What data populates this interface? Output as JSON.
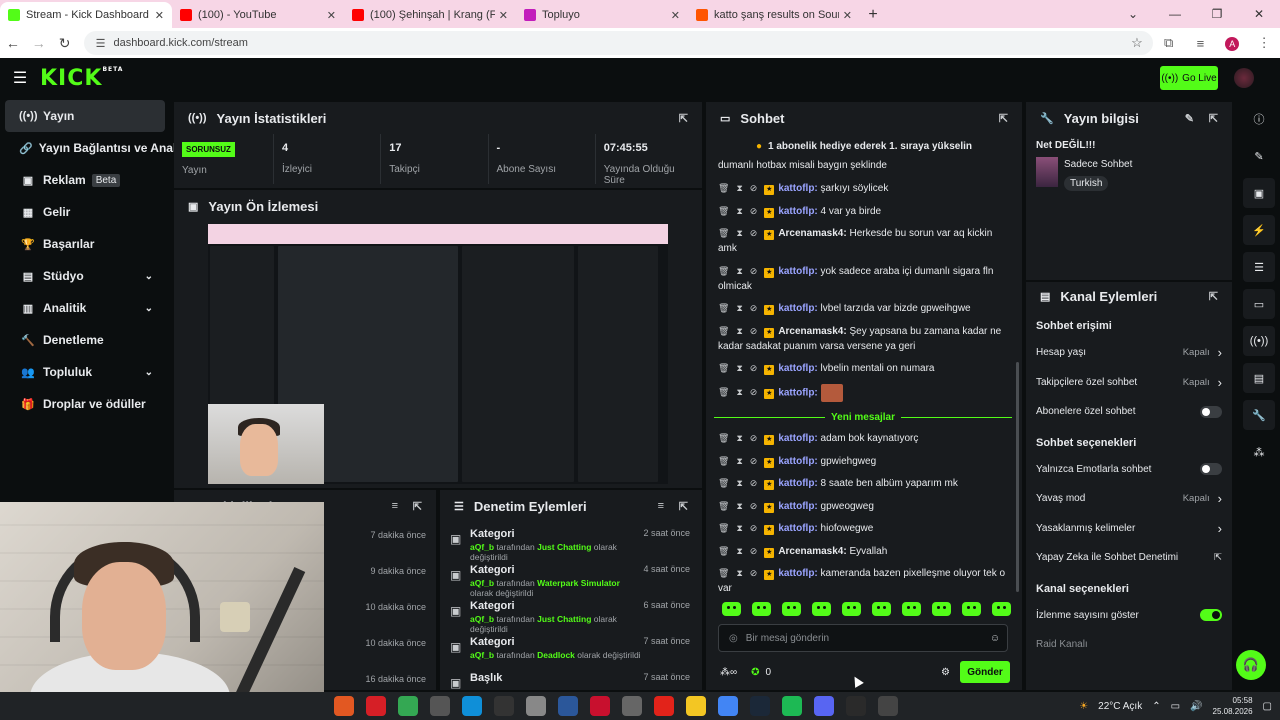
{
  "browser": {
    "tabs": [
      {
        "title": "Stream - Kick Dashboard",
        "color": "#53fc18",
        "active": true
      },
      {
        "title": "(100)                     - YouTube",
        "color": "#ff0000",
        "active": false
      },
      {
        "title": "(100) Şehinşah | Krang (Feat: Hi",
        "color": "#ff0000",
        "active": false
      },
      {
        "title": "Topluyo",
        "color": "#c21cbb",
        "active": false
      },
      {
        "title": "katto şanş results on SoundCloud",
        "color": "#ff5500",
        "active": false
      }
    ],
    "url": "dashboard.kick.com/stream",
    "profile_initial": "A"
  },
  "header": {
    "logo": "KICK",
    "logo_sup": "BETA",
    "go_live": "Go Live"
  },
  "sidebar": {
    "items": [
      {
        "label": "Yayın",
        "icon": "broadcast-icon",
        "glyph": "((•))",
        "active": true
      },
      {
        "label": "Yayın Bağlantısı ve Anahtarı",
        "icon": "link-icon",
        "glyph": "🔗"
      },
      {
        "label": "Reklam",
        "icon": "ad-icon",
        "glyph": "▣",
        "badge": "Beta"
      },
      {
        "label": "Gelir",
        "icon": "revenue-icon",
        "glyph": "▦"
      },
      {
        "label": "Başarılar",
        "icon": "trophy-icon",
        "glyph": "🏆"
      },
      {
        "label": "Stüdyo",
        "icon": "studio-icon",
        "glyph": "▤",
        "expand": true
      },
      {
        "label": "Analitik",
        "icon": "analytics-icon",
        "glyph": "▥",
        "expand": true
      },
      {
        "label": "Denetleme",
        "icon": "moderation-icon",
        "glyph": "🔨"
      },
      {
        "label": "Topluluk",
        "icon": "community-icon",
        "glyph": "👥",
        "expand": true
      },
      {
        "label": "Droplar ve ödüller",
        "icon": "drops-icon",
        "glyph": "🎁"
      }
    ]
  },
  "stats": {
    "title": "Yayın İstatistikleri",
    "status": "SORUNSUZ",
    "status_label": "Yayın",
    "items": [
      {
        "value": "4",
        "label": "İzleyici"
      },
      {
        "value": "17",
        "label": "Takipçi"
      },
      {
        "value": "-",
        "label": "Abone Sayısı"
      },
      {
        "value": "07:45:55",
        "label": "Yayında Olduğu Süre"
      }
    ]
  },
  "preview": {
    "title": "Yayın Ön İzlemesi"
  },
  "activity": {
    "title": "Etkinlik Akışı",
    "times": [
      "7 dakika önce",
      "9 dakika önce",
      "10 dakika önce",
      "10 dakika önce",
      "16 dakika önce"
    ]
  },
  "moderation": {
    "title": "Denetim Eylemleri",
    "rows": [
      {
        "title": "Kategori",
        "time": "2 saat önce",
        "user": "aQf_b",
        "mid": " tarafından ",
        "target": "Just Chatting",
        "end": " olarak değiştirildi"
      },
      {
        "title": "Kategori",
        "time": "4 saat önce",
        "user": "aQf_b",
        "mid": " tarafından ",
        "target": "Waterpark Simulator",
        "end": " olarak değiştirildi"
      },
      {
        "title": "Kategori",
        "time": "6 saat önce",
        "user": "aQf_b",
        "mid": " tarafından ",
        "target": "Just Chatting",
        "end": " olarak değiştirildi"
      },
      {
        "title": "Kategori",
        "time": "7 saat önce",
        "user": "aQf_b",
        "mid": " tarafından ",
        "target": "Deadlock",
        "end": " olarak değiştirildi"
      },
      {
        "title": "Başlık",
        "time": "7 saat önce",
        "user": "",
        "mid": "",
        "target": "",
        "end": ""
      }
    ]
  },
  "chat": {
    "title": "Sohbet",
    "pinned": "1 abonelik hediye ederek 1. sıraya yükselin",
    "top_fragment": "dumanlı hotbax misali baygın şeklinde",
    "messages": [
      {
        "user": "kattoflp",
        "color": "blue",
        "text": "şarkıyı söylicek"
      },
      {
        "user": "kattoflp",
        "color": "blue",
        "text": "4 var ya birde"
      },
      {
        "user": "Arcenamask4",
        "color": "white",
        "text": "Herkesde bu sorun var aq kickin amk"
      },
      {
        "user": "kattoflp",
        "color": "blue",
        "text": "yok sadece araba içi dumanlı sigara fln olmicak"
      },
      {
        "user": "kattoflp",
        "color": "blue",
        "text": "lvbel tarzıda var bizde gpweihgwe"
      },
      {
        "user": "Arcenamask4",
        "color": "white",
        "text": "Şey yapsana bu zamana kadar ne kadar sadakat puanım varsa versene ya geri"
      },
      {
        "user": "kattoflp",
        "color": "blue",
        "text": "lvbelin mentali on numara"
      },
      {
        "user": "kattoflp",
        "color": "blue",
        "text": "",
        "emote": true
      }
    ],
    "new_label": "Yeni mesajlar",
    "new_messages": [
      {
        "user": "kattoflp",
        "color": "blue",
        "text": "adam bok kaynatıyorç"
      },
      {
        "user": "kattoflp",
        "color": "blue",
        "text": "gpwiehgweg"
      },
      {
        "user": "kattoflp",
        "color": "blue",
        "text": "8 saate ben albüm yaparım mk"
      },
      {
        "user": "kattoflp",
        "color": "blue",
        "text": "gpweogweg"
      },
      {
        "user": "kattoflp",
        "color": "blue",
        "text": "hiofowegwe"
      },
      {
        "user": "Arcenamask4",
        "color": "white",
        "text": "Eyvallah"
      },
      {
        "user": "kattoflp",
        "color": "blue",
        "text": "kameranda bazen pixelleşme oluyor tek o var"
      }
    ],
    "input_placeholder": "Bir mesaj gönderin",
    "points": "0",
    "send": "Gönder"
  },
  "stream_info": {
    "title": "Yayın bilgisi",
    "stream_title": "Net DEĞİL!!!",
    "category": "Sadece Sohbet",
    "tag": "Turkish"
  },
  "channel_actions": {
    "title": "Kanal Eylemleri",
    "sections": [
      {
        "heading": "Sohbet erişimi",
        "rows": [
          {
            "label": "Hesap yaşı",
            "value": "Kapalı",
            "kind": "link"
          },
          {
            "label": "Takipçilere özel sohbet",
            "value": "Kapalı",
            "kind": "link"
          },
          {
            "label": "Abonelere özel sohbet",
            "value": "",
            "kind": "toggle",
            "on": false
          }
        ]
      },
      {
        "heading": "Sohbet seçenekleri",
        "rows": [
          {
            "label": "Yalnızca Emotlarla sohbet",
            "value": "",
            "kind": "toggle",
            "on": false
          },
          {
            "label": "Yavaş mod",
            "value": "Kapalı",
            "kind": "link"
          },
          {
            "label": "Yasaklanmış kelimeler",
            "value": "",
            "kind": "link"
          },
          {
            "label": "Yapay Zeka ile Sohbet Denetimi",
            "value": "",
            "kind": "external"
          }
        ]
      },
      {
        "heading": "Kanal seçenekleri",
        "rows": [
          {
            "label": "İzlenme sayısını göster",
            "value": "",
            "kind": "toggle",
            "on": true
          },
          {
            "label": "Raid Kanalı",
            "value": "",
            "kind": "dim"
          }
        ]
      }
    ]
  },
  "taskbar": {
    "weather": "22°C  Açık",
    "time": "05:58",
    "date": "25.08.2026"
  },
  "colors": {
    "accent": "#53fc18",
    "panel": "#181b1e",
    "bg": "#0b0e0f"
  }
}
